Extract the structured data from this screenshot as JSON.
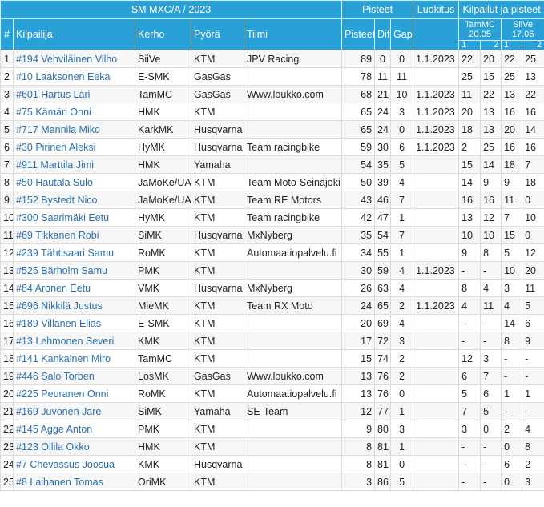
{
  "header": {
    "title": "SM MXC/A / 2023",
    "pisteet": "Pisteet",
    "luokitus": "Luokitus",
    "kilpailut": "Kilpailut ja pisteet",
    "columns": {
      "rank": "#",
      "rider": "Kilpailija",
      "club": "Kerho",
      "bike": "Pyörä",
      "team": "Tiimi",
      "points": "Pisteet",
      "dif": "Dif",
      "gap": "Gap"
    },
    "races": [
      {
        "name": "TamMC",
        "date": "20.05",
        "h1": "1",
        "h2": "2"
      },
      {
        "name": "SiiVe",
        "date": "17.06",
        "h1": "1",
        "h2": "2"
      }
    ]
  },
  "rows": [
    {
      "rank": "1",
      "rider": "#194 Vehviläinen Vilho",
      "club": "SiiVe",
      "bike": "KTM",
      "team": "JPV Racing",
      "points": "89",
      "dif": "0",
      "gap": "0",
      "luokitus": "1.1.2023",
      "r": [
        "22",
        "20",
        "22",
        "25"
      ]
    },
    {
      "rank": "2",
      "rider": "#10 Laaksonen Eeka",
      "club": "E-SMK",
      "bike": "GasGas",
      "team": "",
      "points": "78",
      "dif": "11",
      "gap": "11",
      "luokitus": "",
      "r": [
        "25",
        "15",
        "25",
        "13"
      ]
    },
    {
      "rank": "3",
      "rider": "#601 Hartus Lari",
      "club": "TamMC",
      "bike": "GasGas",
      "team": "Www.loukko.com",
      "points": "68",
      "dif": "21",
      "gap": "10",
      "luokitus": "1.1.2023",
      "r": [
        "11",
        "22",
        "13",
        "22"
      ]
    },
    {
      "rank": "4",
      "rider": "#75 Kämäri Onni",
      "club": "HMK",
      "bike": "KTM",
      "team": "",
      "points": "65",
      "dif": "24",
      "gap": "3",
      "luokitus": "1.1.2023",
      "r": [
        "20",
        "13",
        "16",
        "16"
      ]
    },
    {
      "rank": "5",
      "rider": "#717 Mannila Miko",
      "club": "KarkMK",
      "bike": "Husqvarna",
      "team": "",
      "points": "65",
      "dif": "24",
      "gap": "0",
      "luokitus": "1.1.2023",
      "r": [
        "18",
        "13",
        "20",
        "14"
      ]
    },
    {
      "rank": "6",
      "rider": "#30 Pirinen Aleksi",
      "club": "HyMK",
      "bike": "Husqvarna",
      "team": "Team racingbike",
      "points": "59",
      "dif": "30",
      "gap": "6",
      "luokitus": "1.1.2023",
      "r": [
        "2",
        "25",
        "16",
        "16"
      ]
    },
    {
      "rank": "7",
      "rider": "#911 Marttila Jimi",
      "club": "HMK",
      "bike": "Yamaha",
      "team": "",
      "points": "54",
      "dif": "35",
      "gap": "5",
      "luokitus": "",
      "r": [
        "15",
        "14",
        "18",
        "7"
      ]
    },
    {
      "rank": "8",
      "rider": "#50 Hautala Sulo",
      "club": "JaMoKe/UA",
      "bike": "KTM",
      "team": "Team Moto-Seinäjoki",
      "points": "50",
      "dif": "39",
      "gap": "4",
      "luokitus": "",
      "r": [
        "14",
        "9",
        "9",
        "18"
      ]
    },
    {
      "rank": "9",
      "rider": "#152 Bystedt Nico",
      "club": "JaMoKe/UA",
      "bike": "KTM",
      "team": "Team RE Motors",
      "points": "43",
      "dif": "46",
      "gap": "7",
      "luokitus": "",
      "r": [
        "16",
        "16",
        "11",
        "0"
      ]
    },
    {
      "rank": "10",
      "rider": "#300 Saarimäki Eetu",
      "club": "HyMK",
      "bike": "KTM",
      "team": "Team racingbike",
      "points": "42",
      "dif": "47",
      "gap": "1",
      "luokitus": "",
      "r": [
        "13",
        "12",
        "7",
        "10"
      ]
    },
    {
      "rank": "11",
      "rider": "#69 Tikkanen Robi",
      "club": "SiMK",
      "bike": "Husqvarna",
      "team": "MxNyberg",
      "points": "35",
      "dif": "54",
      "gap": "7",
      "luokitus": "",
      "r": [
        "10",
        "10",
        "15",
        "0"
      ]
    },
    {
      "rank": "12",
      "rider": "#239 Tähtisaari Samu",
      "club": "RoMK",
      "bike": "KTM",
      "team": "Automaatiopalvelu.fi",
      "points": "34",
      "dif": "55",
      "gap": "1",
      "luokitus": "",
      "r": [
        "9",
        "8",
        "5",
        "12"
      ]
    },
    {
      "rank": "13",
      "rider": "#525 Bärholm Samu",
      "club": "PMK",
      "bike": "KTM",
      "team": "",
      "points": "30",
      "dif": "59",
      "gap": "4",
      "luokitus": "1.1.2023",
      "r": [
        "-",
        "-",
        "10",
        "20"
      ]
    },
    {
      "rank": "14",
      "rider": "#84 Aronen Eetu",
      "club": "VMK",
      "bike": "Husqvarna",
      "team": "MxNyberg",
      "points": "26",
      "dif": "63",
      "gap": "4",
      "luokitus": "",
      "r": [
        "8",
        "4",
        "3",
        "11"
      ]
    },
    {
      "rank": "15",
      "rider": "#696 Nikkilä Justus",
      "club": "MieMK",
      "bike": "KTM",
      "team": "Team RX Moto",
      "points": "24",
      "dif": "65",
      "gap": "2",
      "luokitus": "1.1.2023",
      "r": [
        "4",
        "11",
        "4",
        "5"
      ]
    },
    {
      "rank": "16",
      "rider": "#189 Villanen Elias",
      "club": "E-SMK",
      "bike": "KTM",
      "team": "",
      "points": "20",
      "dif": "69",
      "gap": "4",
      "luokitus": "",
      "r": [
        "-",
        "-",
        "14",
        "6"
      ]
    },
    {
      "rank": "17",
      "rider": "#13 Lehmonen Severi",
      "club": "KMK",
      "bike": "KTM",
      "team": "",
      "points": "17",
      "dif": "72",
      "gap": "3",
      "luokitus": "",
      "r": [
        "-",
        "-",
        "8",
        "9"
      ]
    },
    {
      "rank": "18",
      "rider": "#141 Kankainen Miro",
      "club": "TamMC",
      "bike": "KTM",
      "team": "",
      "points": "15",
      "dif": "74",
      "gap": "2",
      "luokitus": "",
      "r": [
        "12",
        "3",
        "-",
        "-"
      ]
    },
    {
      "rank": "19",
      "rider": "#446 Salo Torben",
      "club": "LosMK",
      "bike": "GasGas",
      "team": "Www.loukko.com",
      "points": "13",
      "dif": "76",
      "gap": "2",
      "luokitus": "",
      "r": [
        "6",
        "7",
        "-",
        "-"
      ]
    },
    {
      "rank": "20",
      "rider": "#225 Peuranen Onni",
      "club": "RoMK",
      "bike": "KTM",
      "team": "Automaatiopalvelu.fi",
      "points": "13",
      "dif": "76",
      "gap": "0",
      "luokitus": "",
      "r": [
        "5",
        "6",
        "1",
        "1"
      ]
    },
    {
      "rank": "21",
      "rider": "#169 Juvonen Jare",
      "club": "SiMK",
      "bike": "Yamaha",
      "team": "SE-Team",
      "points": "12",
      "dif": "77",
      "gap": "1",
      "luokitus": "",
      "r": [
        "7",
        "5",
        "-",
        "-"
      ]
    },
    {
      "rank": "22",
      "rider": "#145 Agge Anton",
      "club": "PMK",
      "bike": "KTM",
      "team": "",
      "points": "9",
      "dif": "80",
      "gap": "3",
      "luokitus": "",
      "r": [
        "3",
        "0",
        "2",
        "4"
      ]
    },
    {
      "rank": "23",
      "rider": "#123 Ollila Okko",
      "club": "HMK",
      "bike": "KTM",
      "team": "",
      "points": "8",
      "dif": "81",
      "gap": "1",
      "luokitus": "",
      "r": [
        "-",
        "-",
        "0",
        "8"
      ]
    },
    {
      "rank": "24",
      "rider": "#7 Chevassus Joosua",
      "club": "KMK",
      "bike": "Husqvarna",
      "team": "",
      "points": "8",
      "dif": "81",
      "gap": "0",
      "luokitus": "",
      "r": [
        "-",
        "-",
        "6",
        "2"
      ]
    },
    {
      "rank": "25",
      "rider": "#8 Laihanen Tomas",
      "club": "OriMK",
      "bike": "KTM",
      "team": "",
      "points": "3",
      "dif": "86",
      "gap": "5",
      "luokitus": "",
      "r": [
        "-",
        "-",
        "0",
        "3"
      ]
    }
  ]
}
